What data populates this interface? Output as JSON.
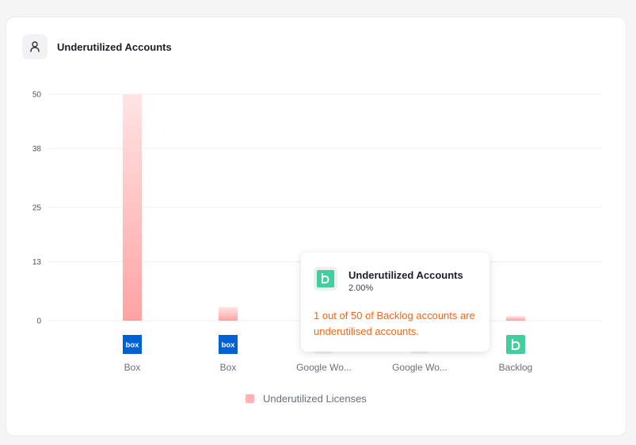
{
  "card": {
    "title": "Underutilized Accounts"
  },
  "chart_data": {
    "type": "bar",
    "categories": [
      "Box",
      "Box",
      "Google Wo...",
      "Google Wo...",
      "Backlog"
    ],
    "category_icons": [
      "box-logo",
      "box-logo",
      "google-workspace-logo",
      "google-workspace-logo",
      "backlog-logo"
    ],
    "series": [
      {
        "name": "Underutilized Licenses",
        "values": [
          50,
          3,
          0,
          0,
          1
        ]
      }
    ],
    "yticks": [
      50,
      38,
      25,
      13,
      0
    ],
    "ylim": [
      0,
      50
    ],
    "legend_position": "bottom",
    "grid": true,
    "bar_color_top": "#ffe4e4",
    "bar_color_bottom": "#ffa3a3"
  },
  "legend": {
    "label": "Underutilized Licenses"
  },
  "tooltip": {
    "title": "Underutilized Accounts",
    "percent": "2.00%",
    "message": "1 out of 50 of Backlog accounts are underutilised accounts."
  },
  "colors": {
    "box": "#0061d5",
    "backlog": "#42ce9f",
    "accent": "#e86a1c"
  }
}
